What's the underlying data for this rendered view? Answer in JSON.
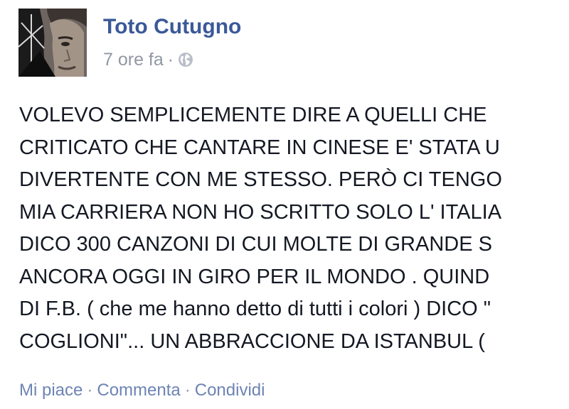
{
  "post": {
    "author": "Toto Cutugno",
    "timestamp": "7 ore fa",
    "separator": "·",
    "privacy_icon": "globe-icon",
    "text_lines": [
      "VOLEVO SEMPLICEMENTE DIRE A QUELLI CHE",
      "CRITICATO CHE CANTARE IN CINESE E' STATA U",
      "DIVERTENTE CON ME STESSO. PERÒ CI TENGO",
      "MIA CARRIERA NON HO SCRITTO SOLO L' ITALIA",
      "DICO 300 CANZONI DI CUI MOLTE DI GRANDE S",
      "ANCORA OGGI IN GIRO PER IL MONDO . QUIND",
      "DI F.B. ( che me hanno detto di tutti i colori ) DICO \"",
      "COGLIONI\"... UN ABBRACCIONE DA ISTANBUL ("
    ]
  },
  "actions": {
    "like": "Mi piace",
    "comment": "Commenta",
    "share": "Condividi",
    "separator": "·"
  },
  "colors": {
    "author": "#3b5998",
    "meta": "#9197a3",
    "action_link": "#6d84b4",
    "body_text": "#141823"
  }
}
